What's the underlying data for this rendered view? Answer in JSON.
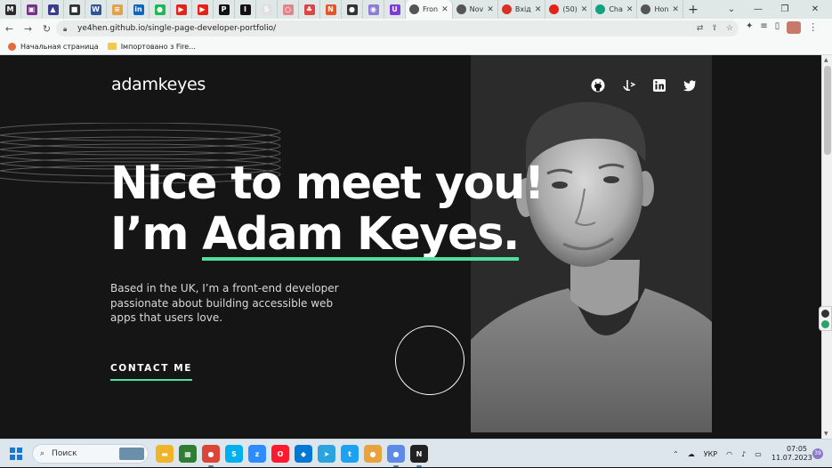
{
  "browser": {
    "tabs": [
      {
        "icon": "moodle-icon",
        "color": "#2b2b2b",
        "glyph": "M"
      },
      {
        "icon": "app-icon",
        "color": "#7b2d8e",
        "glyph": "▣"
      },
      {
        "icon": "triangle-app-icon",
        "color": "#3b3b8f",
        "glyph": "▲"
      },
      {
        "icon": "film-icon",
        "color": "#333333",
        "glyph": "■"
      },
      {
        "icon": "word-icon",
        "color": "#2b579a",
        "glyph": "W"
      },
      {
        "icon": "books-icon",
        "color": "#e5a14a",
        "glyph": "≡"
      },
      {
        "icon": "linkedin-icon",
        "color": "#0a66c2",
        "glyph": "in"
      },
      {
        "icon": "spotify-icon",
        "color": "#1db954",
        "glyph": "●"
      },
      {
        "icon": "youtube-icon",
        "color": "#e62117",
        "glyph": "▶"
      },
      {
        "icon": "youtube-icon",
        "color": "#e62117",
        "glyph": "▶"
      },
      {
        "icon": "patreon-icon",
        "color": "#111111",
        "glyph": "P"
      },
      {
        "icon": "dev-icon",
        "color": "#111111",
        "glyph": "I"
      },
      {
        "icon": "s-app-icon",
        "color": "#e0e0e0",
        "glyph": "S"
      },
      {
        "icon": "opera-icon",
        "color": "#e0858b",
        "glyph": "○"
      },
      {
        "icon": "leaf-icon",
        "color": "#d44",
        "glyph": "♣"
      },
      {
        "icon": "news-icon",
        "color": "#e3552b",
        "glyph": "N"
      },
      {
        "icon": "github-icon",
        "color": "#333333",
        "glyph": "●"
      },
      {
        "icon": "messenger-icon",
        "color": "#8a7cd9",
        "glyph": "◉"
      },
      {
        "icon": "u-app-icon",
        "color": "#7d3cd6",
        "glyph": "U"
      }
    ],
    "open_tabs": [
      {
        "label": "Fron",
        "icon_color": "#555555",
        "active": true
      },
      {
        "label": "Nov",
        "icon_color": "#555555",
        "active": false
      },
      {
        "label": "Вхід",
        "icon_color": "#d93025",
        "active": false
      },
      {
        "label": "(50)",
        "icon_color": "#e62117",
        "active": false
      },
      {
        "label": "Cha",
        "icon_color": "#10a37f",
        "active": false
      },
      {
        "label": "Hon",
        "icon_color": "#555555",
        "active": false
      }
    ],
    "new_tab_label": "+",
    "url": "ye4hen.github.io/single-page-developer-portfolio/",
    "bookmarks": [
      {
        "label": "Начальная страница"
      },
      {
        "label": "Імпортовано з Fire..."
      }
    ]
  },
  "page": {
    "logo": "adamkeyes",
    "social": [
      "github-icon",
      "frontend-mentor-icon",
      "linkedin-icon",
      "twitter-icon"
    ],
    "headline_line1": "Nice to meet you!",
    "headline_prefix": "I’m ",
    "headline_name": "Adam Keyes.",
    "intro": "Based in the UK, I’m a front-end developer passionate about building accessible web apps that users love.",
    "contact_label": "CONTACT ME",
    "accent_color": "#4ee1a0"
  },
  "taskbar": {
    "search_label": "Поиск",
    "apps": [
      {
        "icon": "file-explorer-icon",
        "color": "#f0b429",
        "glyph": "▬",
        "running": false
      },
      {
        "icon": "store-icon",
        "color": "#2e7d32",
        "glyph": "▦",
        "running": false
      },
      {
        "icon": "chrome-icon",
        "color": "#db4437",
        "glyph": "●",
        "running": true
      },
      {
        "icon": "skype-icon",
        "color": "#00aff0",
        "glyph": "S",
        "running": false
      },
      {
        "icon": "zoom-icon",
        "color": "#2d8cff",
        "glyph": "z",
        "running": false
      },
      {
        "icon": "opera-icon",
        "color": "#ff1b2d",
        "glyph": "O",
        "running": false
      },
      {
        "icon": "vscode-icon",
        "color": "#0078d4",
        "glyph": "◆",
        "running": false
      },
      {
        "icon": "telegram-icon",
        "color": "#2aa3df",
        "glyph": "➤",
        "running": false
      },
      {
        "icon": "twitter-icon",
        "color": "#1da1f2",
        "glyph": "t",
        "running": false
      },
      {
        "icon": "chrome-alt-icon",
        "color": "#e8a33d",
        "glyph": "●",
        "running": false
      },
      {
        "icon": "chrome-profile-icon",
        "color": "#5c8ae6",
        "glyph": "●",
        "running": true
      },
      {
        "icon": "notion-icon",
        "color": "#222222",
        "glyph": "N",
        "running": true
      }
    ],
    "tray_lang": "УКР",
    "time": "07:05",
    "date": "11.07.2023",
    "notifications": "39"
  }
}
